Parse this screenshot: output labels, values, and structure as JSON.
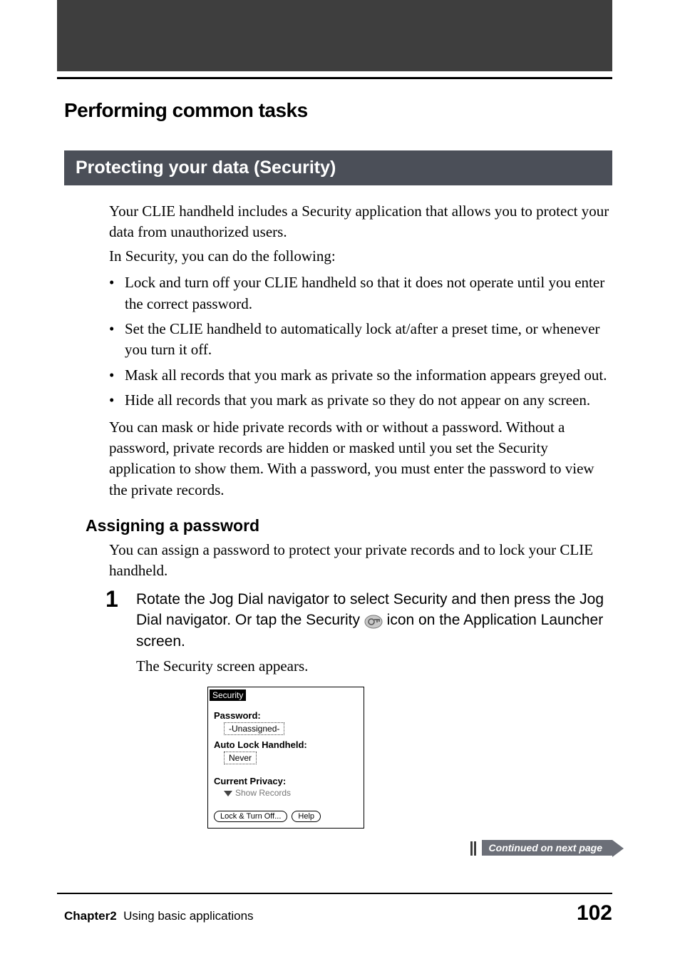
{
  "header": {
    "chapter_heading": "Performing common tasks"
  },
  "section": {
    "title": "Protecting your data (Security)",
    "intro_p1": "Your CLIE handheld includes a Security application that allows you to protect your data from unauthorized users.",
    "intro_p2": "In Security, you can do the following:",
    "bullets": [
      "Lock and turn off your CLIE handheld so that it does not operate until you enter the correct password.",
      "Set the CLIE handheld to automatically lock at/after a preset time, or whenever you turn it off.",
      "Mask all records that you mark as private so the information appears greyed out.",
      "Hide all records that you mark as private so they do not appear on any screen."
    ],
    "after_bullets": "You can mask or hide private records with or without a password. Without a password, private records are hidden or masked until you set the Security application to show them. With a password, you must enter the password to view the private records."
  },
  "subsection": {
    "heading": "Assigning a password",
    "intro": "You can assign a password to protect your private records and to lock your CLIE handheld.",
    "step_number": "1",
    "step_head_a": "Rotate the Jog Dial navigator to select Security and then press the Jog Dial navigator. Or tap the Security ",
    "step_head_b": " icon on the Application Launcher screen.",
    "step_body": "The Security screen appears.",
    "icon_name": "security-icon"
  },
  "screenshot": {
    "title": "Security",
    "password_label": "Password:",
    "password_value": "-Unassigned-",
    "autolock_label": "Auto Lock Handheld:",
    "autolock_value": "Never",
    "privacy_label": "Current Privacy:",
    "privacy_value": "Show Records",
    "button_lock": "Lock & Turn Off...",
    "button_help": "Help"
  },
  "continue_label": "Continued on next page",
  "footer": {
    "chapter_label": "Chapter2",
    "chapter_desc": "Using basic applications",
    "page_number": "102"
  }
}
